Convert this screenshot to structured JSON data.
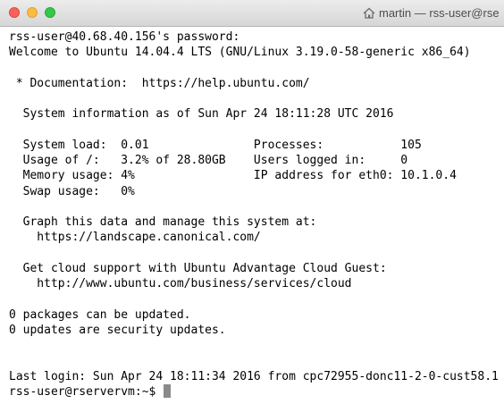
{
  "window": {
    "title": "martin — rss-user@rse",
    "title_icon": "home-icon"
  },
  "terminal": {
    "lines": [
      "rss-user@40.68.40.156's password:",
      "Welcome to Ubuntu 14.04.4 LTS (GNU/Linux 3.19.0-58-generic x86_64)",
      "",
      " * Documentation:  https://help.ubuntu.com/",
      "",
      "  System information as of Sun Apr 24 18:11:28 UTC 2016",
      "",
      "  System load:  0.01               Processes:           105",
      "  Usage of /:   3.2% of 28.80GB    Users logged in:     0",
      "  Memory usage: 4%                 IP address for eth0: 10.1.0.4",
      "  Swap usage:   0%",
      "",
      "  Graph this data and manage this system at:",
      "    https://landscape.canonical.com/",
      "",
      "  Get cloud support with Ubuntu Advantage Cloud Guest:",
      "    http://www.ubuntu.com/business/services/cloud",
      "",
      "0 packages can be updated.",
      "0 updates are security updates.",
      "",
      "",
      "Last login: Sun Apr 24 18:11:34 2016 from cpc72955-donc11-2-0-cust58.1"
    ],
    "prompt": "rss-user@rservervm:~$ "
  }
}
